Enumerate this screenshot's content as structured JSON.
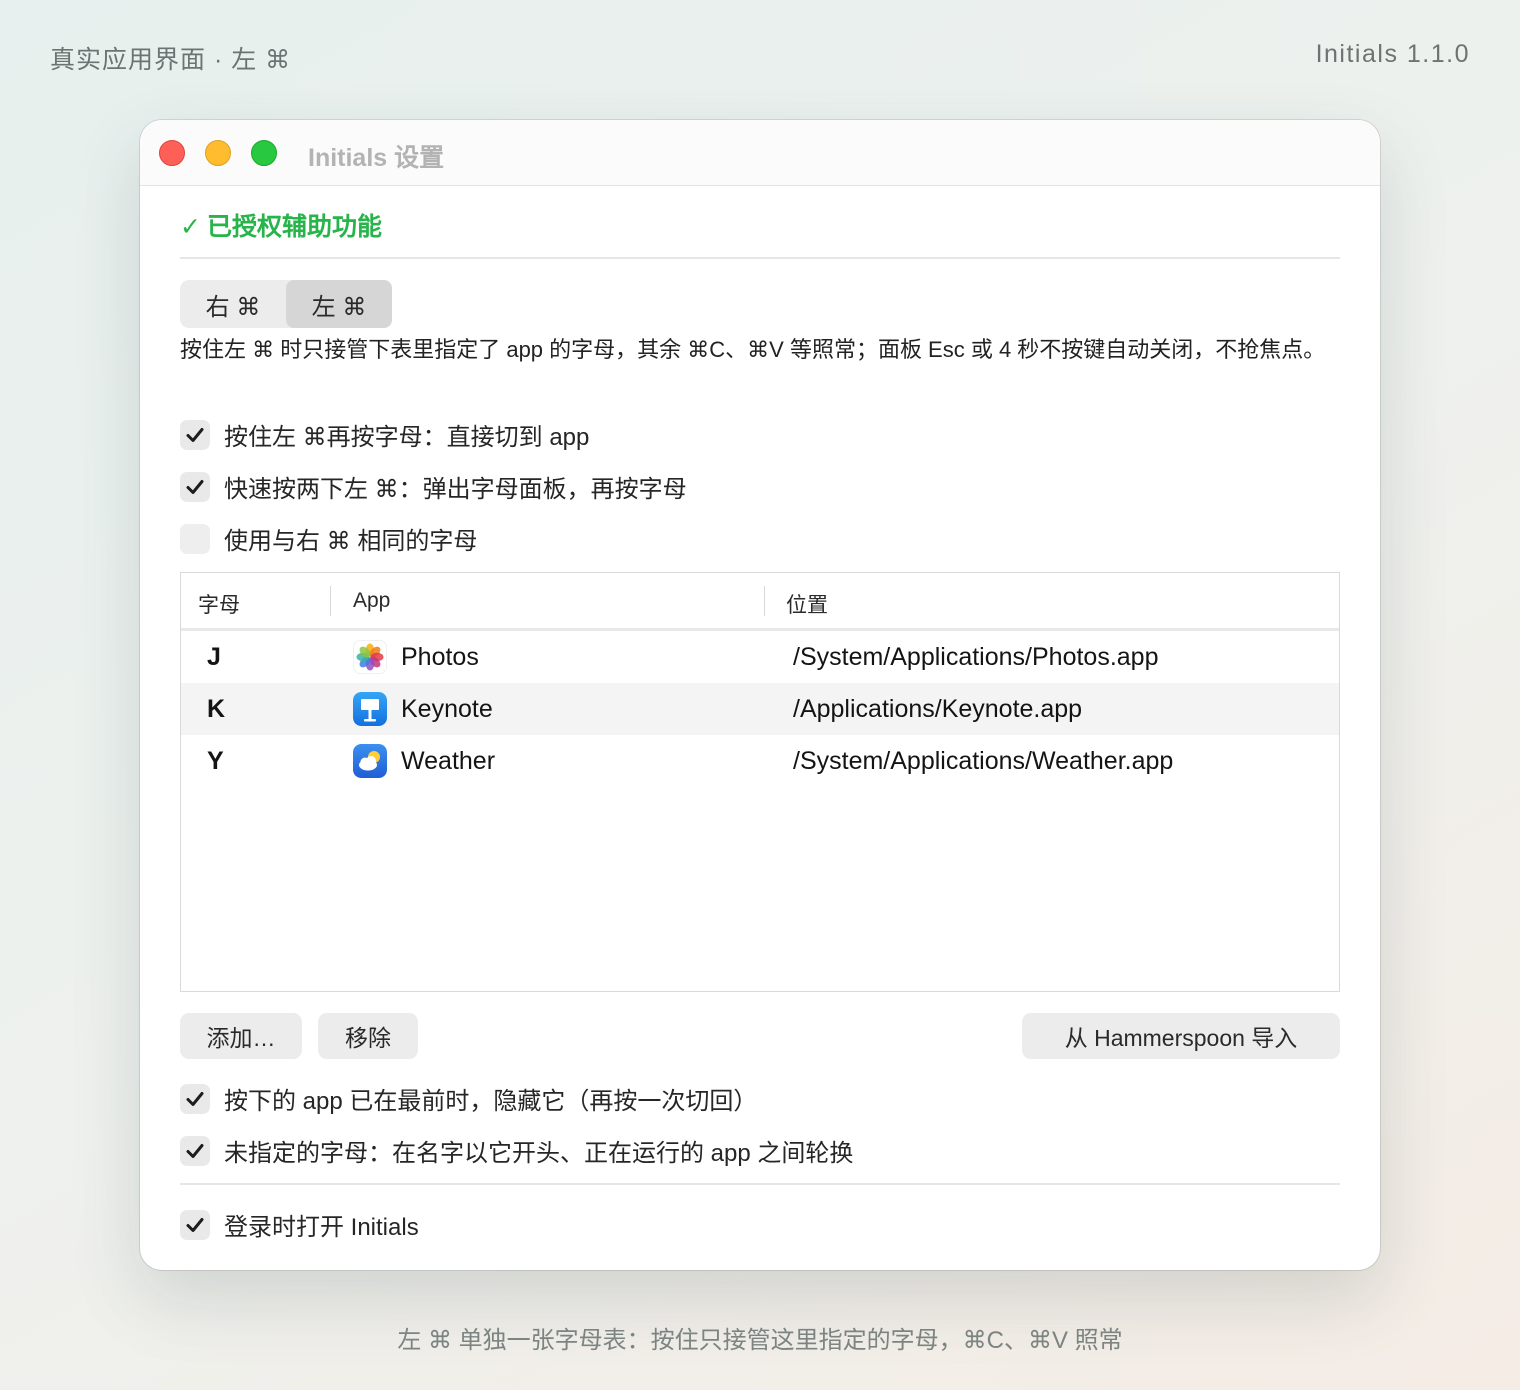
{
  "captions": {
    "top_left": "真实应用界面 · 左 ⌘",
    "top_right": "Initials 1.1.0",
    "bottom": "左 ⌘ 单独一张字母表：按住只接管这里指定的字母，⌘C、⌘V 照常"
  },
  "window": {
    "title": "Initials 设置"
  },
  "auth_status": {
    "icon": "✓",
    "text": "已授权辅助功能",
    "color": "#27b44a"
  },
  "segmented": {
    "items": [
      "右 ⌘",
      "左 ⌘"
    ],
    "selected": "左 ⌘"
  },
  "description": "按住左 ⌘ 时只接管下表里指定了 app 的字母，其余 ⌘C、⌘V 等照常；面板 Esc 或 4 秒不按键自动关闭，不抢焦点。",
  "options": [
    {
      "label": "按住左 ⌘再按字母：直接切到 app",
      "checked": true
    },
    {
      "label": "快速按两下左 ⌘：弹出字母面板，再按字母",
      "checked": true
    },
    {
      "label": "使用与右 ⌘ 相同的字母",
      "checked": false
    }
  ],
  "table": {
    "columns": [
      "字母",
      "App",
      "位置"
    ],
    "rows": [
      {
        "letter": "J",
        "app": "Photos",
        "icon": "photos-icon",
        "path": "/System/Applications/Photos.app"
      },
      {
        "letter": "K",
        "app": "Keynote",
        "icon": "keynote-icon",
        "path": "/Applications/Keynote.app"
      },
      {
        "letter": "Y",
        "app": "Weather",
        "icon": "weather-icon",
        "path": "/System/Applications/Weather.app"
      }
    ]
  },
  "buttons": {
    "add": "添加…",
    "remove": "移除",
    "import": "从 Hammerspoon 导入"
  },
  "bottom_options": [
    {
      "label": "按下的 app 已在最前时，隐藏它（再按一次切回）",
      "checked": true
    },
    {
      "label": "未指定的字母：在名字以它开头、正在运行的 app 之间轮换",
      "checked": true
    }
  ],
  "login_option": {
    "label": "登录时打开 Initials",
    "checked": true
  }
}
